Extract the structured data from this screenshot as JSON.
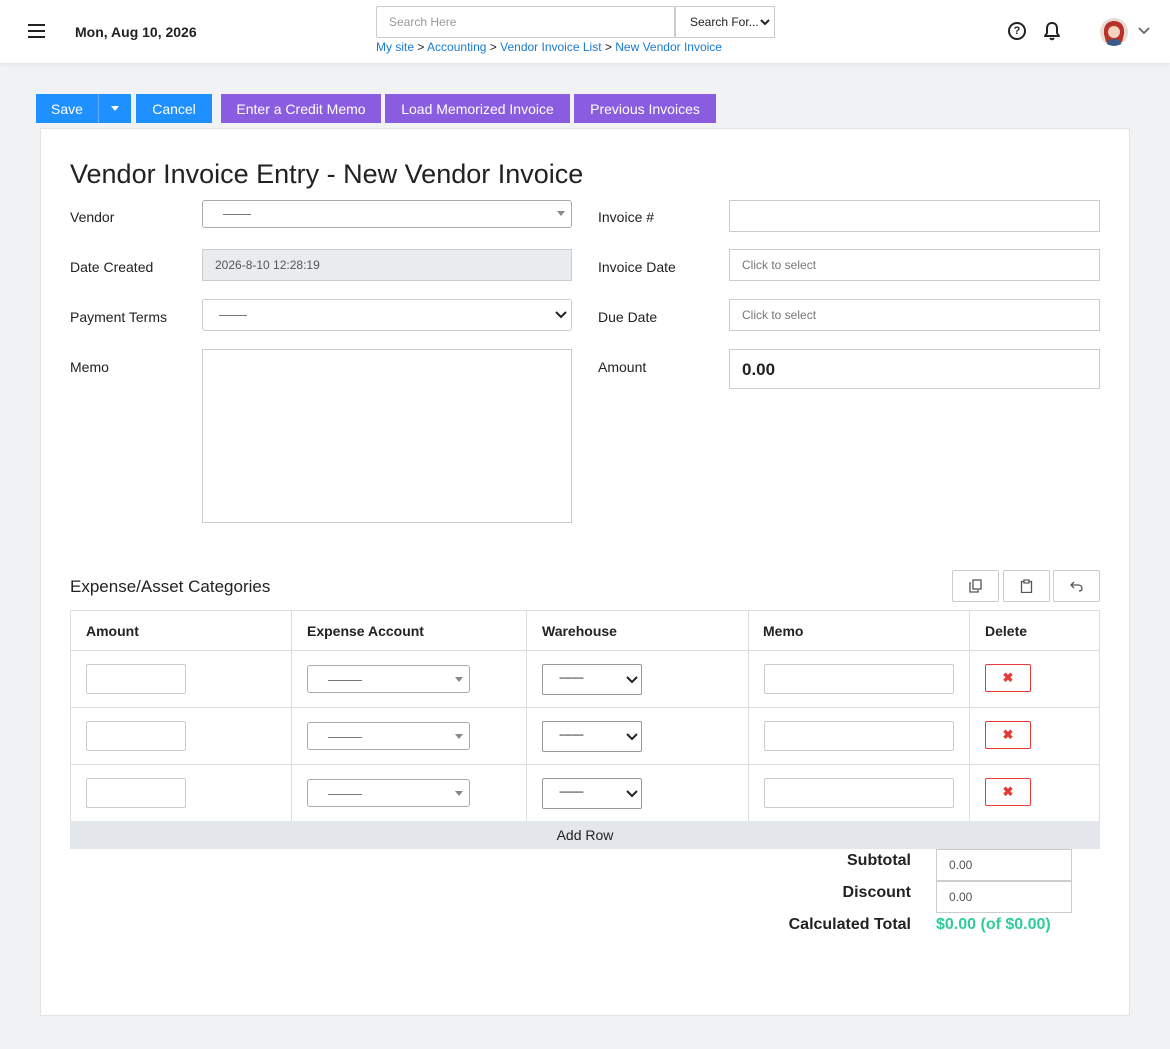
{
  "header": {
    "date": "Mon, Aug 10, 2026",
    "search_placeholder": "Search Here",
    "search_for_label": "Search For...",
    "breadcrumb": [
      "My site",
      "Accounting",
      "Vendor Invoice List",
      "New Vendor Invoice"
    ],
    "breadcrumb_sep": ">"
  },
  "actions": {
    "save": "Save",
    "cancel": "Cancel",
    "credit_memo": "Enter a Credit Memo",
    "load_memorized": "Load Memorized Invoice",
    "previous_invoices": "Previous Invoices"
  },
  "form": {
    "title": "Vendor Invoice Entry - New Vendor Invoice",
    "vendor_label": "Vendor",
    "date_created_label": "Date Created",
    "date_created_value": "2026-8-10 12:28:19",
    "payment_terms_label": "Payment Terms",
    "memo_label": "Memo",
    "invoice_no_label": "Invoice #",
    "invoice_date_label": "Invoice Date",
    "invoice_date_placeholder": "Click to select",
    "due_date_label": "Due Date",
    "due_date_placeholder": "Click to select",
    "amount_label": "Amount",
    "amount_value": "0.00"
  },
  "categories": {
    "title": "Expense/Asset Categories",
    "columns": [
      "Amount",
      "Expense Account",
      "Warehouse",
      "Memo",
      "Delete"
    ],
    "warehouse_placeholder": "---------",
    "row_count": 3,
    "add_row_label": "Add Row"
  },
  "totals": {
    "subtotal_label": "Subtotal",
    "subtotal_value": "0.00",
    "discount_label": "Discount",
    "discount_value": "0.00",
    "calculated_label": "Calculated Total",
    "calculated_value": "$0.00 (of $0.00)"
  },
  "colors": {
    "primary": "#1e90ff",
    "secondary": "#8a5ce0",
    "link": "#1a7bd0",
    "danger": "#e53935",
    "success": "#2ecc9a"
  }
}
